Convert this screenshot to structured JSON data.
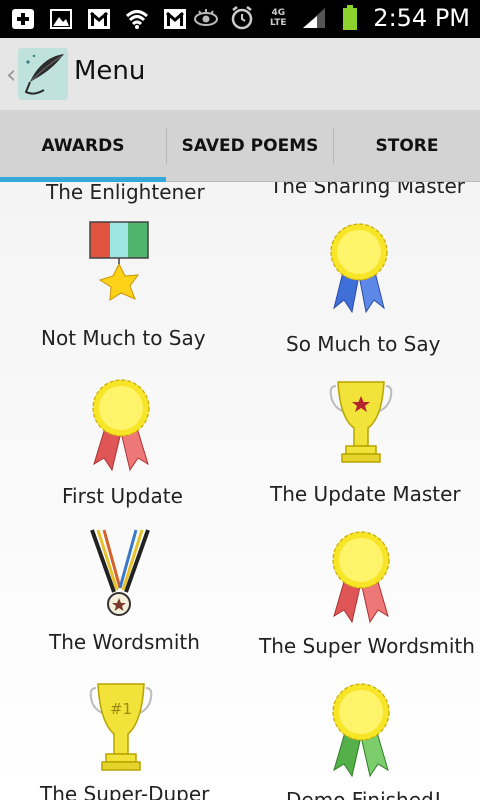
{
  "app": {
    "title": "Menu"
  },
  "status_bar": {
    "time": "2:54 PM",
    "network": "4G LTE"
  },
  "tabs": [
    {
      "label": "AWARDS",
      "selected": true
    },
    {
      "label": "SAVED POEMS",
      "selected": false
    },
    {
      "label": "STORE",
      "selected": false
    }
  ],
  "awards": [
    {
      "name": "The Enlightener",
      "icon": "award-icon"
    },
    {
      "name": "The Sharing Master",
      "icon": "award-icon"
    },
    {
      "name": "Not Much to Say",
      "icon": "star-medal-icon"
    },
    {
      "name": "So Much to Say",
      "icon": "blue-rosette-icon"
    },
    {
      "name": "First Update",
      "icon": "red-rosette-icon"
    },
    {
      "name": "The Update Master",
      "icon": "star-trophy-icon"
    },
    {
      "name": "The Wordsmith",
      "icon": "necklace-medal-icon"
    },
    {
      "name": "The Super Wordsmith",
      "icon": "red-rosette-icon"
    },
    {
      "name": "The Super-Duper",
      "icon": "number-one-trophy-icon"
    },
    {
      "name": "Demo Finished!",
      "icon": "green-rosette-icon"
    }
  ],
  "trophy_text": "#1",
  "colors": {
    "tab_indicator": "#33a9dc",
    "rosette_yellow": "#f7e627",
    "ribbon_red": "#e05656",
    "ribbon_blue": "#3f6fd8",
    "ribbon_green": "#56b04a"
  }
}
